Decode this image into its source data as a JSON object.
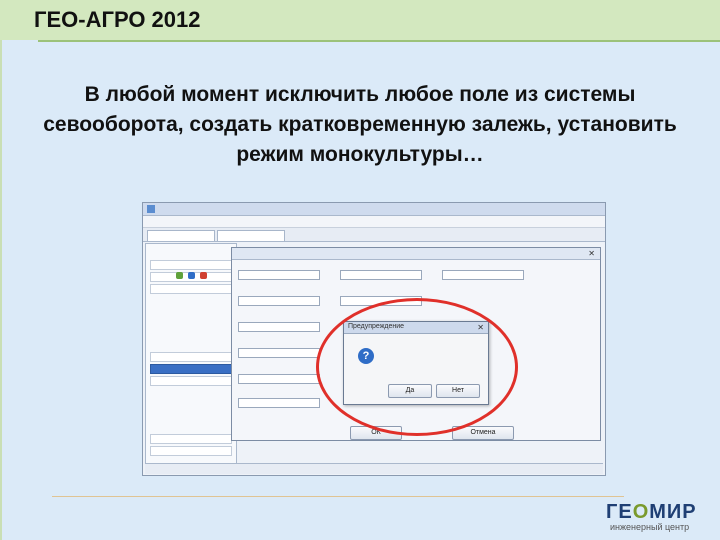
{
  "slide": {
    "title": "ГЕО-АГРО 2012",
    "lead_text": "В любой момент исключить любое поле из системы севооборота, создать кратковременную залежь, установить режим монокультуры…",
    "logo": {
      "word_pre": "ГЕ",
      "word_o": "О",
      "word_post": "МИР",
      "tagline": "инженерный центр"
    },
    "colors": {
      "accent_green": "#d3e8bf",
      "highlight_red": "#e0302a",
      "logo_blue": "#1f3f74"
    }
  },
  "app": {
    "confirm_dialog": {
      "title": "Предупреждение",
      "question_icon": "question-icon",
      "ok_label": "Да",
      "no_label": "Нет"
    },
    "main_dialog": {
      "ok_label": "ОК",
      "cancel_label": "Отмена"
    }
  }
}
